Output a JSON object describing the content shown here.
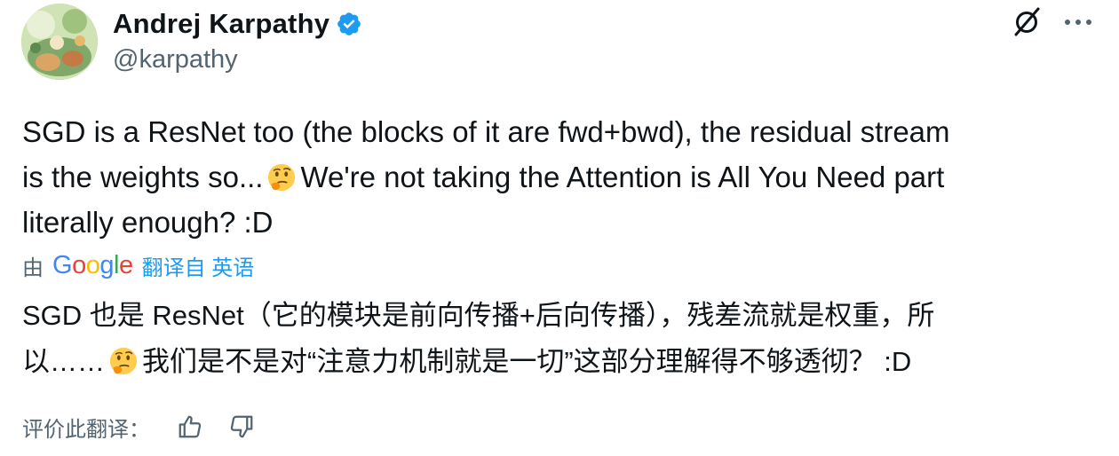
{
  "author": {
    "display_name": "Andrej Karpathy",
    "handle": "@karpathy",
    "verified": true,
    "verified_color": "#1d9bf0"
  },
  "header": {
    "grok_icon": "grok-icon",
    "more_icon": "more-horizontal-icon"
  },
  "tweet": {
    "lines": [
      "SGD is a ResNet too (the blocks of it are fwd+bwd), the residual stream",
      "is the weights so...",
      "We're not taking the Attention is All You Need part",
      "literally enough? :D"
    ],
    "emoji": "thinking-face-emoji"
  },
  "translation": {
    "prefix": "由",
    "provider": "Google",
    "link": "翻译自 英语",
    "lines": [
      "SGD 也是 ResNet（它的模块是前向传播+后向传播），残差流就是权重，所",
      "以……",
      "我们是不是对“注意力机制就是一切”这部分理解得不够透彻？ :D"
    ]
  },
  "rating": {
    "label": "评价此翻译：",
    "thumbs_up_icon": "thumbs-up-icon",
    "thumbs_down_icon": "thumbs-down-icon"
  },
  "colors": {
    "text_primary": "#0f1419",
    "text_secondary": "#536471",
    "link": "#1d9bf0"
  }
}
